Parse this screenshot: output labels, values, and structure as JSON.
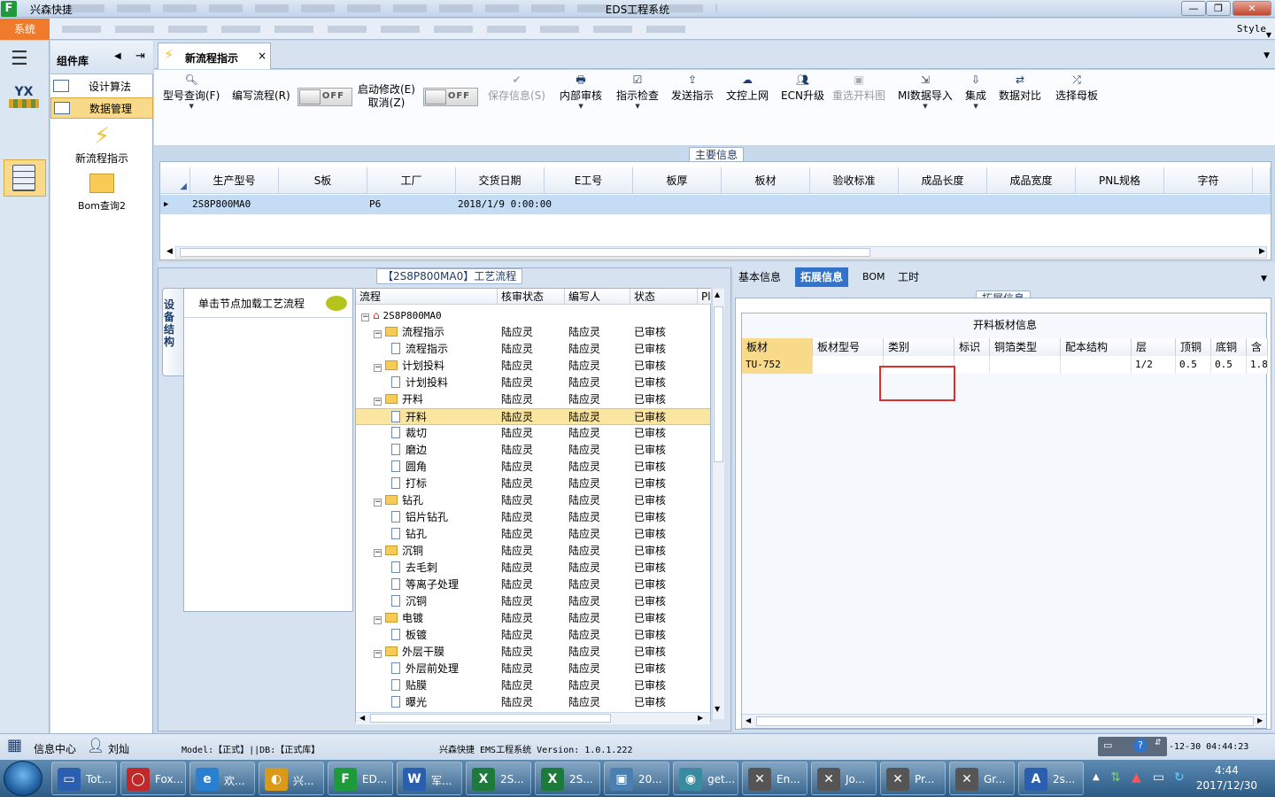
{
  "window": {
    "app_name": "兴森快捷",
    "title": "EDS工程系统",
    "min": "—",
    "max": "❐",
    "close": "✕"
  },
  "menu": {
    "system": "系统",
    "style": "Style"
  },
  "components": {
    "title": "组件库",
    "nav": [
      {
        "label": "设计算法"
      },
      {
        "label": "数据管理"
      }
    ],
    "new_flow": "新流程指示",
    "bom_query": "Bom查询2"
  },
  "doc_tab": {
    "label": "新流程指示",
    "close": "×"
  },
  "toolbar": {
    "model_query": "型号查询(F)",
    "write_flow": "编写流程(R)",
    "enable_edit": "启动修改(E)",
    "cancel": "取消(Z)",
    "toggle_off": "OFF",
    "save": "保存信息(S)",
    "internal_review": "内部审核",
    "check": "指示检查",
    "send": "发送指示",
    "upload": "文控上网",
    "ecn": "ECN升级",
    "reselect": "重选开料图",
    "mi_import": "MI数据导入",
    "integrate": "集成",
    "compare": "数据对比",
    "select_master": "选择母板"
  },
  "main_info": {
    "label": "主要信息",
    "columns": [
      "生产型号",
      "S板",
      "工厂",
      "交货日期",
      "E工号",
      "板厚",
      "板材",
      "验收标准",
      "成品长度",
      "成品宽度",
      "PNL规格",
      "字符"
    ],
    "row": {
      "model": "2S8P800MA0",
      "factory": "P6",
      "date": "2018/1/9 0:00:00"
    }
  },
  "flow_panel": {
    "title": "【2S8P800MA0】工艺流程",
    "vtab": "设备结构",
    "node_hint": "单击节点加载工艺流程",
    "columns": [
      "流程",
      "核审状态",
      "编写人",
      "状态",
      "Pl"
    ],
    "root": "2S8P800MA0",
    "rows": [
      {
        "label": "流程指示",
        "level": 1,
        "folder": true
      },
      {
        "label": "流程指示",
        "level": 2,
        "folder": false
      },
      {
        "label": "计划投料",
        "level": 1,
        "folder": true
      },
      {
        "label": "计划投料",
        "level": 2,
        "folder": false
      },
      {
        "label": "开料",
        "level": 1,
        "folder": true
      },
      {
        "label": "开料",
        "level": 2,
        "folder": false,
        "selected": true
      },
      {
        "label": "裁切",
        "level": 2,
        "folder": false
      },
      {
        "label": "磨边",
        "level": 2,
        "folder": false
      },
      {
        "label": "圆角",
        "level": 2,
        "folder": false
      },
      {
        "label": "打标",
        "level": 2,
        "folder": false
      },
      {
        "label": "钻孔",
        "level": 1,
        "folder": true
      },
      {
        "label": "铝片钻孔",
        "level": 2,
        "folder": false
      },
      {
        "label": "钻孔",
        "level": 2,
        "folder": false
      },
      {
        "label": "沉铜",
        "level": 1,
        "folder": true
      },
      {
        "label": "去毛刺",
        "level": 2,
        "folder": false
      },
      {
        "label": "等离子处理",
        "level": 2,
        "folder": false
      },
      {
        "label": "沉铜",
        "level": 2,
        "folder": false
      },
      {
        "label": "电镀",
        "level": 1,
        "folder": true
      },
      {
        "label": "板镀",
        "level": 2,
        "folder": false
      },
      {
        "label": "外层干膜",
        "level": 1,
        "folder": true
      },
      {
        "label": "外层前处理",
        "level": 2,
        "folder": false
      },
      {
        "label": "贴膜",
        "level": 2,
        "folder": false
      },
      {
        "label": "曝光",
        "level": 2,
        "folder": false
      }
    ],
    "review": "陆应灵",
    "author": "陆应灵",
    "status": "已审核"
  },
  "right_tabs": {
    "basic": "基本信息",
    "ext": "拓展信息",
    "bom": "BOM",
    "hours": "工时"
  },
  "ext": {
    "group": "拓展信息",
    "title": "开料板材信息",
    "columns": [
      "板材",
      "板材型号",
      "类别",
      "标识",
      "铜箔类型",
      "配本结构",
      "层",
      "顶铜",
      "底铜",
      "含铜"
    ],
    "row": [
      "TU-752",
      "",
      "",
      "",
      "",
      "",
      "1/2",
      "0.5",
      "0.5",
      "1.8"
    ]
  },
  "status": {
    "info_center": "信息中心",
    "user": "刘灿",
    "model": "Model:【正式】||DB:【正式库】",
    "version": "兴森快捷 EMS工程系统 Version: 1.0.1.222",
    "time": "-12-30 04:44:23"
  },
  "taskbar": {
    "items": [
      {
        "label": "Tot..."
      },
      {
        "label": "Fox..."
      },
      {
        "label": "欢..."
      },
      {
        "label": "兴..."
      },
      {
        "label": "ED..."
      },
      {
        "label": "军..."
      },
      {
        "label": "2S..."
      },
      {
        "label": "2S..."
      },
      {
        "label": "20..."
      },
      {
        "label": "get..."
      },
      {
        "label": "En..."
      },
      {
        "label": "Jo..."
      },
      {
        "label": "Pr..."
      },
      {
        "label": "Gr..."
      },
      {
        "label": "2s..."
      }
    ],
    "time": "4:44",
    "date": "2017/12/30"
  },
  "colors": {
    "accent": "#3173c9",
    "system_menu": "#f07a2b",
    "selection": "#fbe6a1",
    "highlight_red": "#d9302b"
  }
}
